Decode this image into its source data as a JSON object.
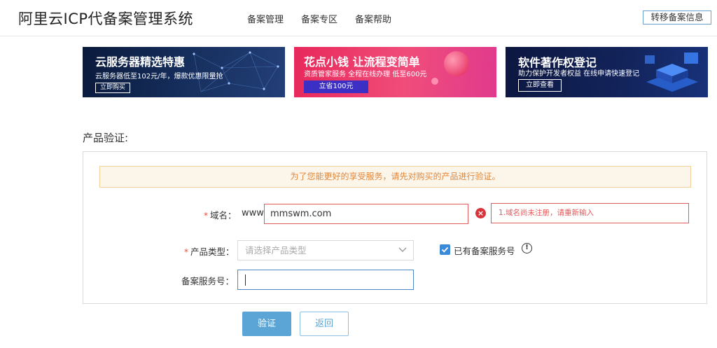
{
  "header": {
    "title": "阿里云ICP代备案管理系统",
    "nav": [
      "备案管理",
      "备案专区",
      "备案帮助"
    ],
    "transfer_button": "转移备案信息"
  },
  "banners": [
    {
      "title": "云服务器精选特惠",
      "subtitle": "云服务器低至102元/年，爆款优惠限量抢",
      "button": "立即购买"
    },
    {
      "title": "花点小钱 让流程变简单",
      "subtitle": "资质管家服务 全程在线办理 低至600元",
      "button": "立省100元"
    },
    {
      "title": "软件著作权登记",
      "subtitle": "助力保护开发者权益 在线申请快速登记",
      "button": "立即查看"
    }
  ],
  "section_title": "产品验证:",
  "form": {
    "notice": "为了您能更好的享受服务，请先对购买的产品进行验证。",
    "domain": {
      "required_mark": "*",
      "label": "域名：",
      "prefix": "www.",
      "value": "mmswm.com",
      "error_icon": "error-x-icon",
      "error": "1.域名尚未注册，请重新输入"
    },
    "product_type": {
      "required_mark": "*",
      "label": "产品类型：",
      "placeholder": "请选择产品类型"
    },
    "has_service_number": {
      "label": "已有备案服务号",
      "checked": true,
      "info_icon": "!"
    },
    "service_number": {
      "label": "备案服务号：",
      "value": ""
    }
  },
  "actions": {
    "verify": "验证",
    "back": "返回"
  },
  "colors": {
    "accent": "#5aa5d6",
    "error": "#e05b5b",
    "notice_text": "#e1863a",
    "notice_bg": "#fcf6ea"
  }
}
